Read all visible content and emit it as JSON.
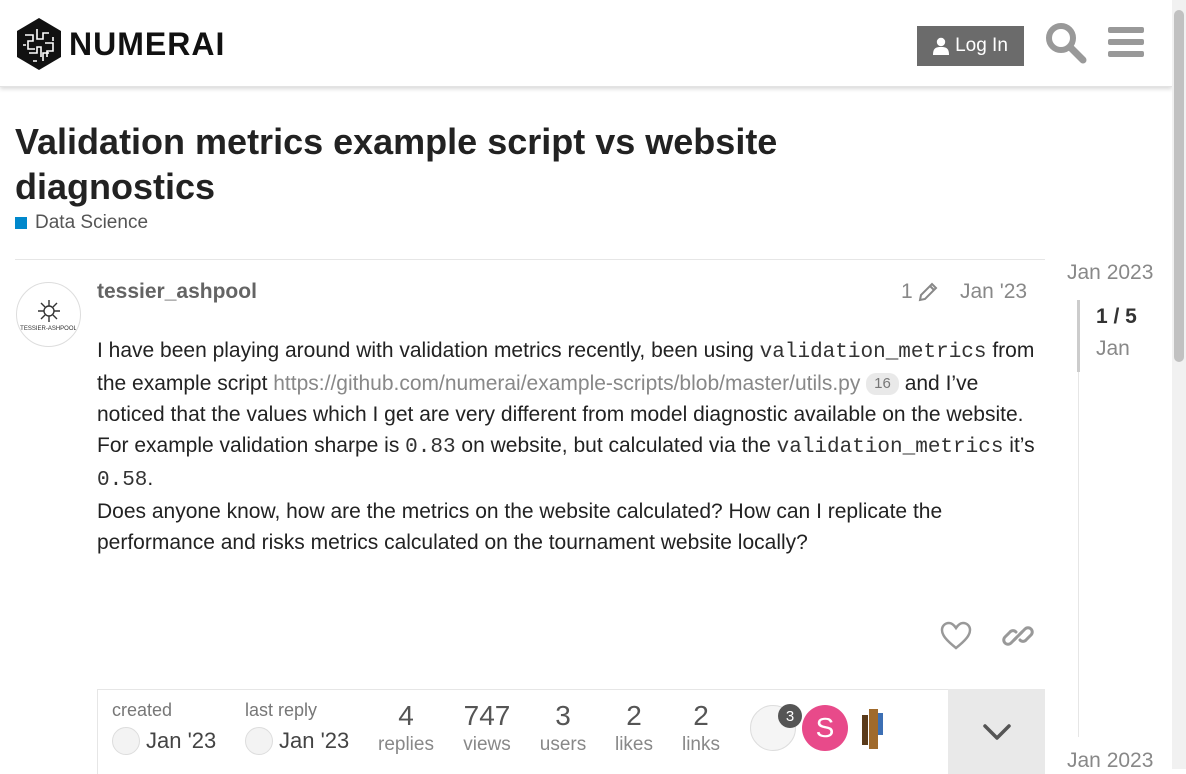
{
  "header": {
    "logo_text": "NUMERAI",
    "login_label": "Log In",
    "icons": [
      "search-icon",
      "hamburger-menu-icon",
      "user-icon"
    ]
  },
  "topic": {
    "title": "Validation metrics example script vs website diagnostics",
    "category": "Data Science",
    "category_color": "#0088cc"
  },
  "post": {
    "username": "tessier_ashpool",
    "avatar_text": "TESSIER-ASHPOOL",
    "edit_count": "1",
    "date": "Jan '23",
    "p1_text1": "I have been playing around with validation metrics recently, been using ",
    "p1_code1": "validation_metrics",
    "p1_text2": " from the example script ",
    "p1_link": "https://github.com/numerai/example-scripts/blob/master/utils.py",
    "p1_link_clicks": "16",
    "p1_text3": " and I’ve noticed that the values which I get are very different from model diagnostic available on the website. For example validation sharpe is ",
    "p1_code2": "0.83",
    "p1_text4": " on website, but calculated via the ",
    "p1_code3": "validation_metrics",
    "p1_text5": " it’s ",
    "p1_code4": "0.58",
    "p1_text6": ".",
    "p2": "Does anyone know, how are the metrics on the website calculated? How can I replicate the performance and risks metrics calculated on the tournament website locally?"
  },
  "topic_map": {
    "created_label": "created",
    "created_date": "Jan '23",
    "last_reply_label": "last reply",
    "last_reply_date": "Jan '23",
    "stats": [
      {
        "n": "4",
        "l": "replies"
      },
      {
        "n": "747",
        "l": "views"
      },
      {
        "n": "3",
        "l": "users"
      },
      {
        "n": "2",
        "l": "likes"
      },
      {
        "n": "2",
        "l": "links"
      }
    ],
    "participant_count_badge": "3",
    "participant2_initial": "S",
    "participant2_color": "#e84a8a"
  },
  "timeline": {
    "start_date": "Jan 2023",
    "position": "1 / 5",
    "position_date": "Jan",
    "end_date": "Jan 2023"
  }
}
